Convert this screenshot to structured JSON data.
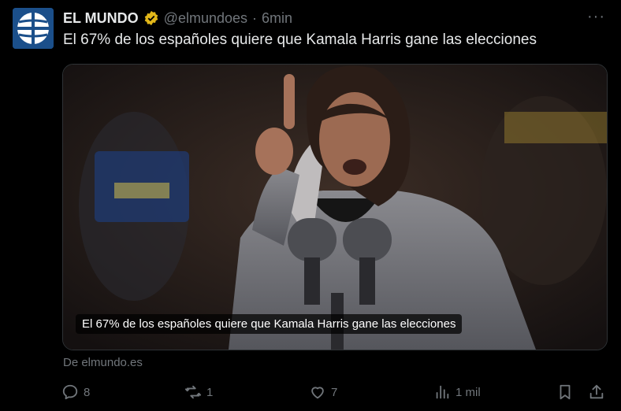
{
  "tweet": {
    "name": "EL MUNDO",
    "handle": "@elmundoes",
    "separator": "·",
    "time": "6min",
    "more": "···",
    "text": "El 67% de los españoles quiere que Kamala Harris gane las elecciones",
    "media_caption": "El 67% de los españoles quiere que Kamala Harris gane las elecciones",
    "source": "De elmundo.es"
  },
  "actions": {
    "replies": "8",
    "retweets": "1",
    "likes": "7",
    "views": "1 mil"
  },
  "colors": {
    "background": "#000000",
    "text": "#e7e9ea",
    "muted": "#71767b",
    "verified": "#e2b719",
    "avatar": "#1b4f8a"
  },
  "icons": {
    "reply": "reply-icon",
    "retweet": "retweet-icon",
    "like": "heart-icon",
    "views": "views-icon",
    "bookmark": "bookmark-icon",
    "share": "share-icon"
  }
}
